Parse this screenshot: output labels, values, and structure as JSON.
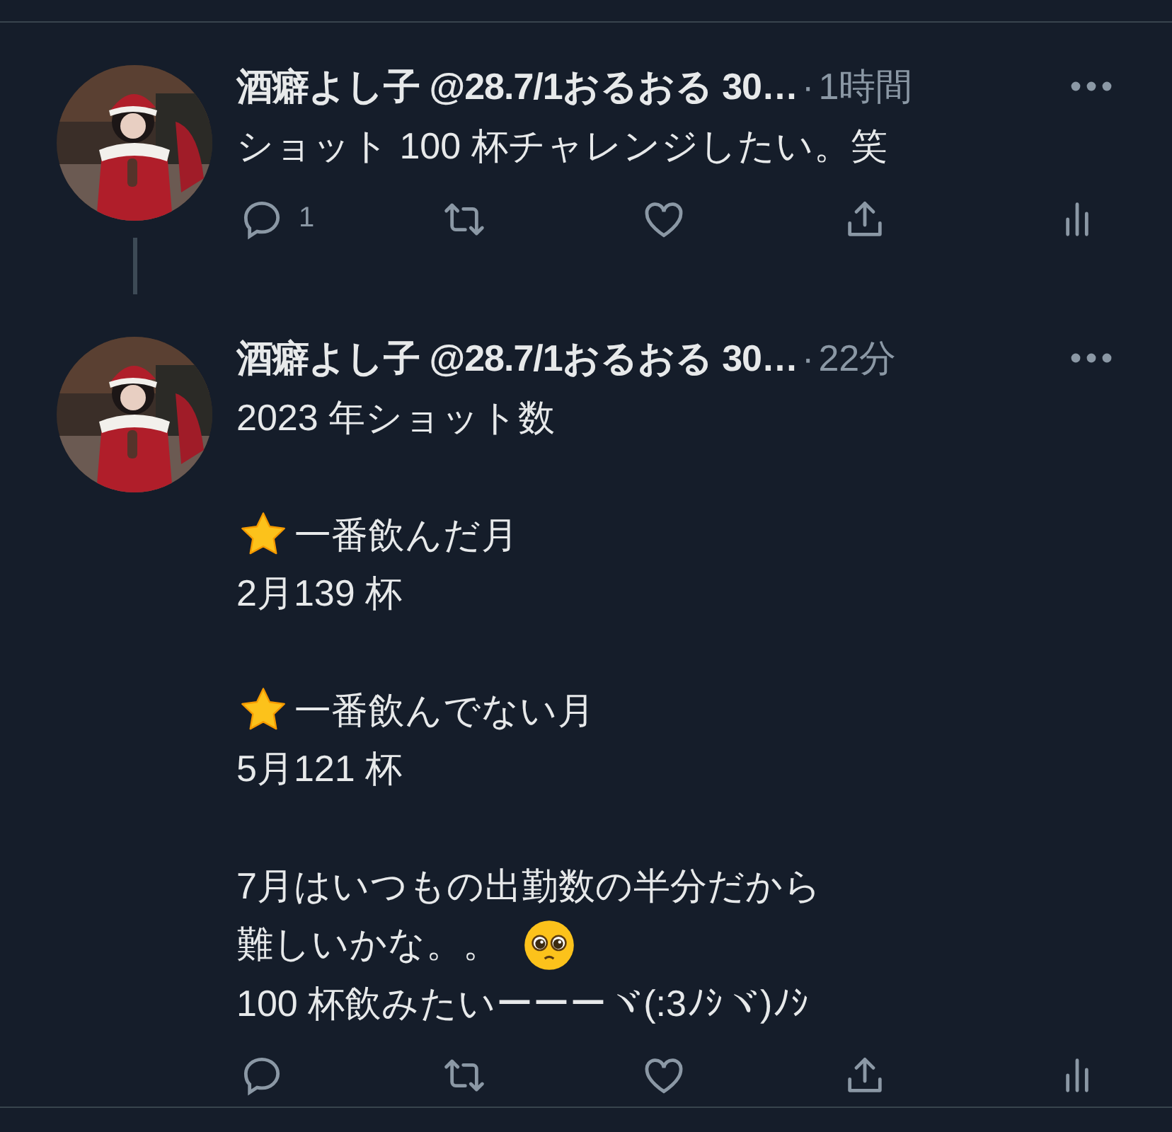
{
  "tweets": [
    {
      "author": "酒癖よし子 @28.7/1おるおる 30…",
      "separator": "·",
      "time": "1時間",
      "thread_below": true,
      "paragraphs": [
        [
          {
            "kind": "plain",
            "text": "ショット 100 杯チャレンジしたい。笑"
          }
        ]
      ],
      "actions": {
        "replies": "1"
      }
    },
    {
      "author": "酒癖よし子 @28.7/1おるおる 30…",
      "separator": "·",
      "time": "22分",
      "thread_below": false,
      "paragraphs": [
        [
          {
            "kind": "plain",
            "text": "2023 年ショット数"
          }
        ],
        [
          {
            "kind": "star",
            "text": "一番飲んだ月"
          },
          {
            "kind": "plain",
            "text": "2月139 杯"
          }
        ],
        [
          {
            "kind": "star",
            "text": "一番飲んでない月"
          },
          {
            "kind": "plain",
            "text": "5月121 杯"
          }
        ],
        [
          {
            "kind": "plain",
            "text": "7月はいつもの出勤数の半分だから"
          },
          {
            "kind": "emoji",
            "text": "難しいかな。。"
          },
          {
            "kind": "plain",
            "text": "100 杯飲みたいーーーヾ(:3ﾉｼヾ)ﾉｼ"
          }
        ]
      ]
    }
  ]
}
